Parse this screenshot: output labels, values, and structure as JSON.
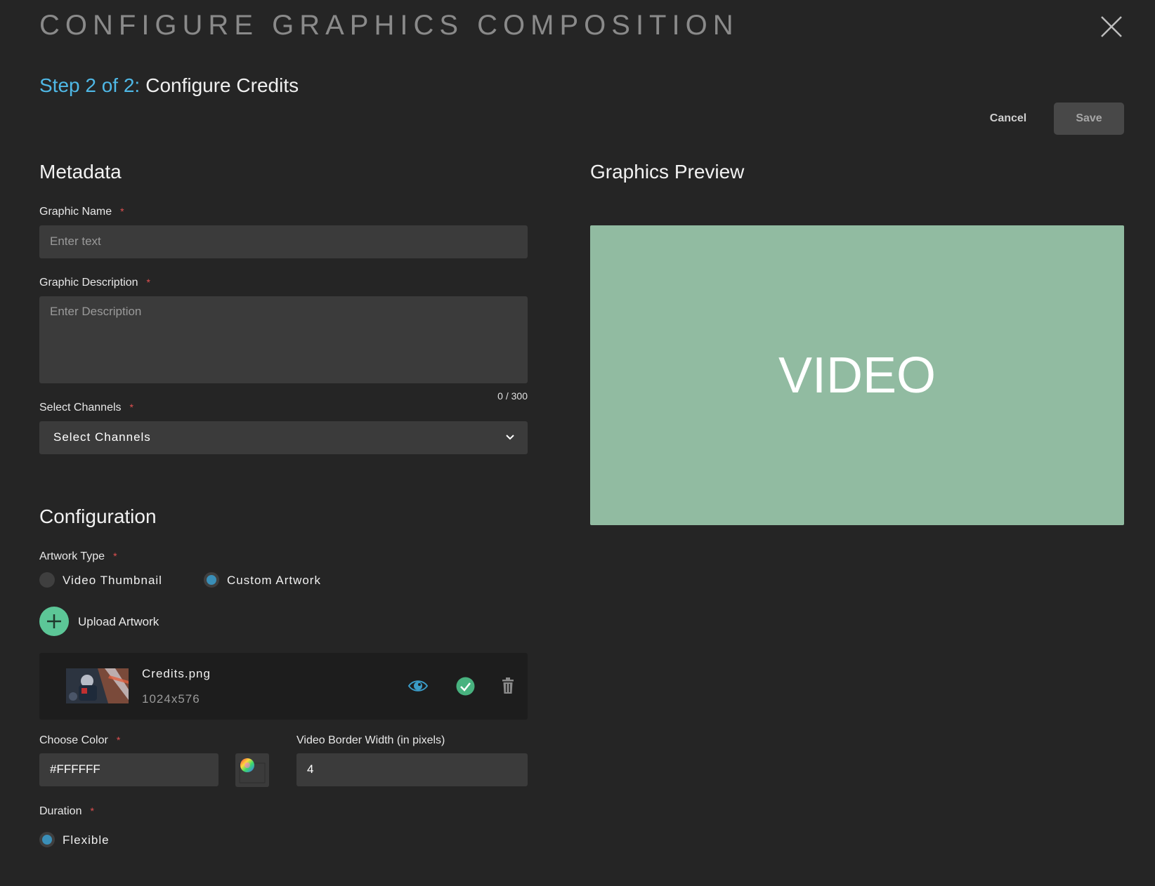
{
  "header": {
    "title": "CONFIGURE GRAPHICS COMPOSITION"
  },
  "step": {
    "label": "Step 2 of 2:",
    "name": "Configure Credits"
  },
  "actions": {
    "cancel": "Cancel",
    "save": "Save"
  },
  "metadata": {
    "heading": "Metadata",
    "graphic_name": {
      "label": "Graphic Name",
      "required": "*",
      "placeholder": "Enter text"
    },
    "graphic_description": {
      "label": "Graphic Description",
      "required": "*",
      "placeholder": "Enter Description",
      "counter": "0 / 300"
    },
    "channels": {
      "label": "Select Channels",
      "required": "*",
      "value": "Select Channels"
    }
  },
  "configuration": {
    "heading": "Configuration",
    "artwork_type": {
      "label": "Artwork Type",
      "required": "*",
      "options": [
        {
          "label": "Video Thumbnail",
          "selected": false
        },
        {
          "label": "Custom Artwork",
          "selected": true
        }
      ]
    },
    "upload_label": "Upload Artwork",
    "file": {
      "name": "Credits.png",
      "dimensions": "1024x576"
    },
    "color": {
      "label": "Choose Color",
      "required": "*",
      "value": "#FFFFFF"
    },
    "border": {
      "label": "Video Border Width (in pixels)",
      "value": "4"
    },
    "duration": {
      "label": "Duration",
      "required": "*",
      "options": [
        {
          "label": "Flexible",
          "selected": true
        }
      ]
    }
  },
  "preview": {
    "heading": "Graphics Preview",
    "placeholder": "VIDEO",
    "color": "#91bba1"
  },
  "colors": {
    "accent": "#4fb8e6",
    "success": "#5cc697",
    "background": "#252525"
  }
}
